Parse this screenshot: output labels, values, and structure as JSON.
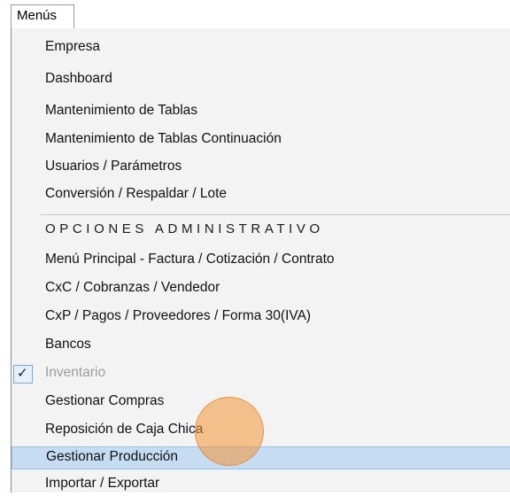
{
  "menubar": {
    "menu_label": "Menús"
  },
  "menu": {
    "items": [
      {
        "label": "Empresa"
      },
      {
        "label": "Dashboard"
      },
      {
        "label": "Mantenimiento de Tablas"
      },
      {
        "label": "Mantenimiento de Tablas Continuación"
      },
      {
        "label": "Usuarios / Parámetros"
      },
      {
        "label": "Conversión / Respaldar / Lote"
      },
      {
        "label": "OPCIONES ADMINISTRATIVO"
      },
      {
        "label": "Menú Principal - Factura / Cotización / Contrato"
      },
      {
        "label": "CxC / Cobranzas / Vendedor"
      },
      {
        "label": "CxP / Pagos / Proveedores / Forma 30(IVA)"
      },
      {
        "label": "Bancos"
      },
      {
        "label": "Inventario",
        "checked": true,
        "disabled": true
      },
      {
        "label": "Gestionar Compras"
      },
      {
        "label": "Reposición de Caja Chica"
      },
      {
        "label": "Gestionar Producción",
        "highlighted": true
      },
      {
        "label": "Importar / Exportar"
      }
    ],
    "check_glyph": "✓",
    "highlight_color": "#c6dcf2",
    "cursor_color": "#f39634"
  }
}
